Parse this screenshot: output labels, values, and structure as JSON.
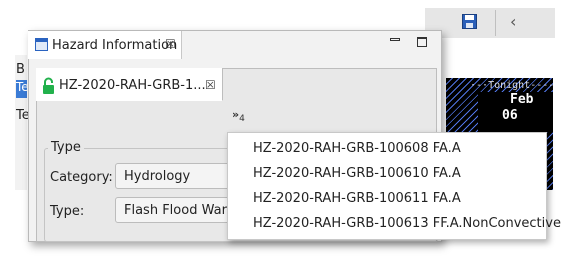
{
  "background": {
    "left_fragments": [
      "B",
      "Te",
      "Te"
    ],
    "timeline": {
      "header": "Tonight",
      "month": "Feb",
      "day": "06"
    }
  },
  "view": {
    "tab_label": "Hazard Information",
    "close_glyph": "☒"
  },
  "editor": {
    "tab_label": "HZ-2020-RAH-GRB-1...",
    "close_glyph": "☒",
    "overflow_glyph": "»",
    "overflow_count": "4"
  },
  "type_group": {
    "title": "Type",
    "category_label": "Category:",
    "category_value": "Hydrology",
    "type_label": "Type:",
    "type_value": "Flash Flood Warni"
  },
  "dropdown": {
    "items": [
      "HZ-2020-RAH-GRB-100608 FA.A",
      "HZ-2020-RAH-GRB-100610 FA.A",
      "HZ-2020-RAH-GRB-100611 FA.A",
      "HZ-2020-RAH-GRB-100613 FF.A.NonConvective"
    ]
  },
  "colors": {
    "lock": "#22b14c",
    "accent": "#2a63c0"
  }
}
